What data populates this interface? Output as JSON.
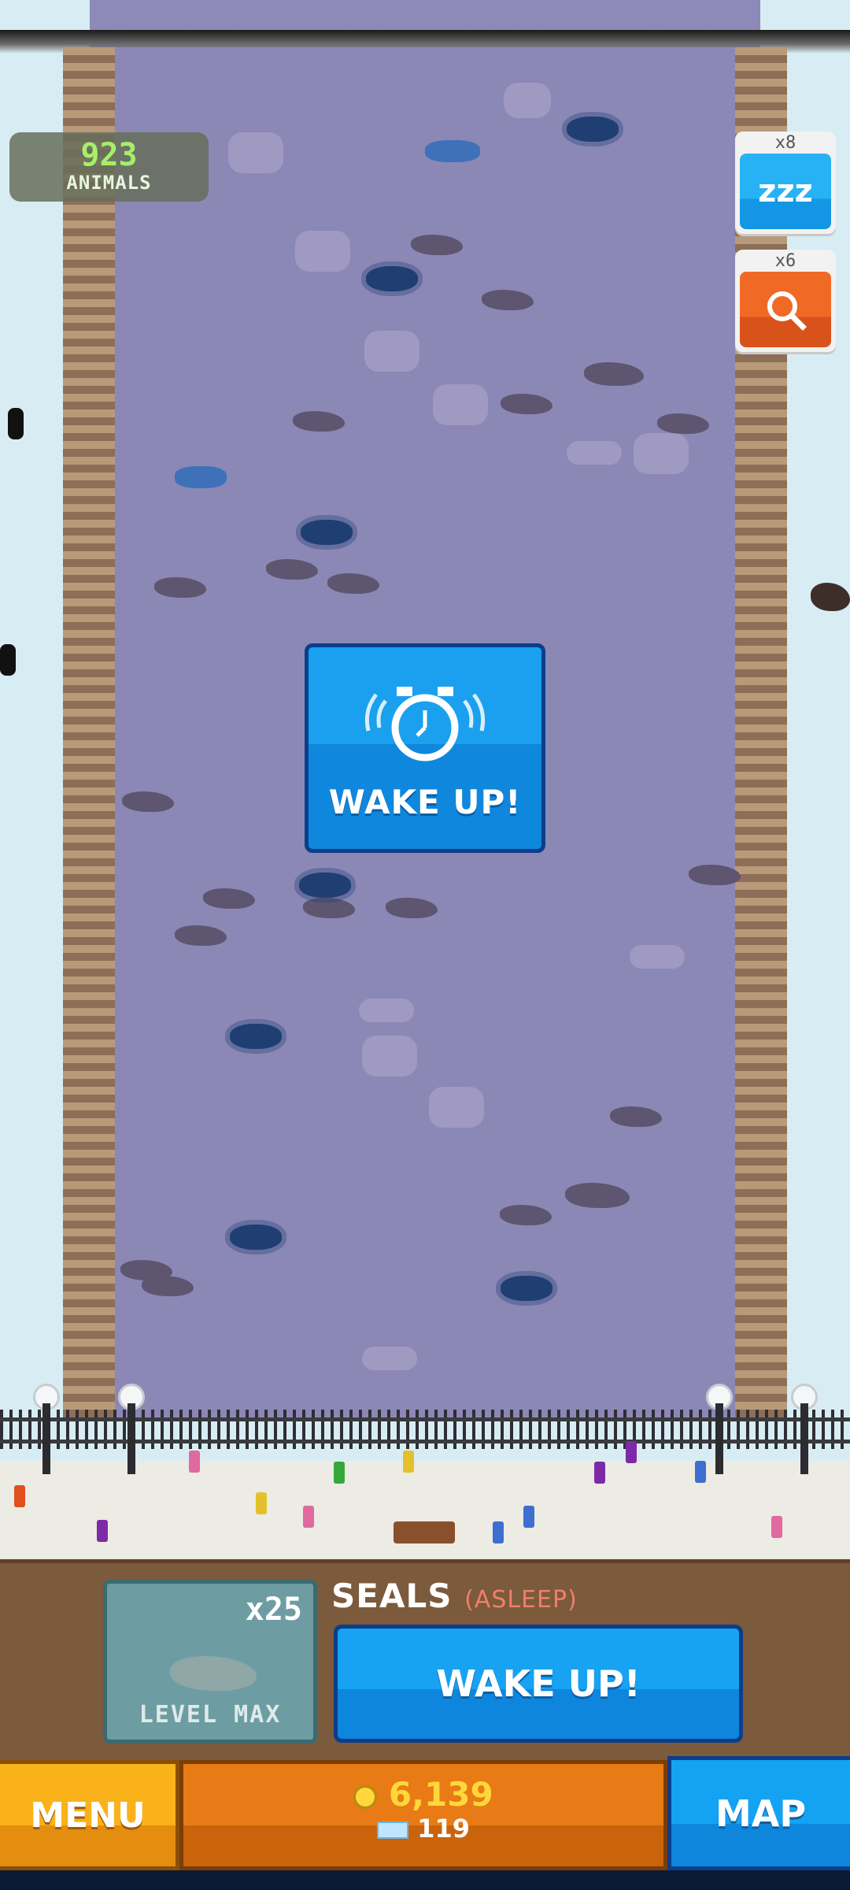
{
  "hud": {
    "animals_count": "923",
    "animals_label": "ANIMALS"
  },
  "powerups": [
    {
      "count": "x8",
      "icon": "sleep-zzz-icon",
      "glyph": "zzz",
      "color": "#1aa0ee"
    },
    {
      "count": "x6",
      "icon": "magnifier-icon",
      "color": "#e0561c"
    }
  ],
  "center_prompt": {
    "label": "WAKE UP!",
    "icon": "alarm-clock-icon"
  },
  "species_panel": {
    "multiplier": "x25",
    "level_text": "LEVEL MAX",
    "name": "SEALS",
    "status": "(ASLEEP)",
    "action_label": "WAKE UP!"
  },
  "bottom_bar": {
    "menu_label": "MENU",
    "coins": "6,139",
    "gems": "119",
    "map_label": "MAP"
  },
  "colors": {
    "water": "#8b88b6",
    "accent_blue": "#1aa0ee",
    "menu_orange": "#fab21b",
    "coins_yellow": "#ffd73a",
    "status_red": "#f07f6a"
  }
}
